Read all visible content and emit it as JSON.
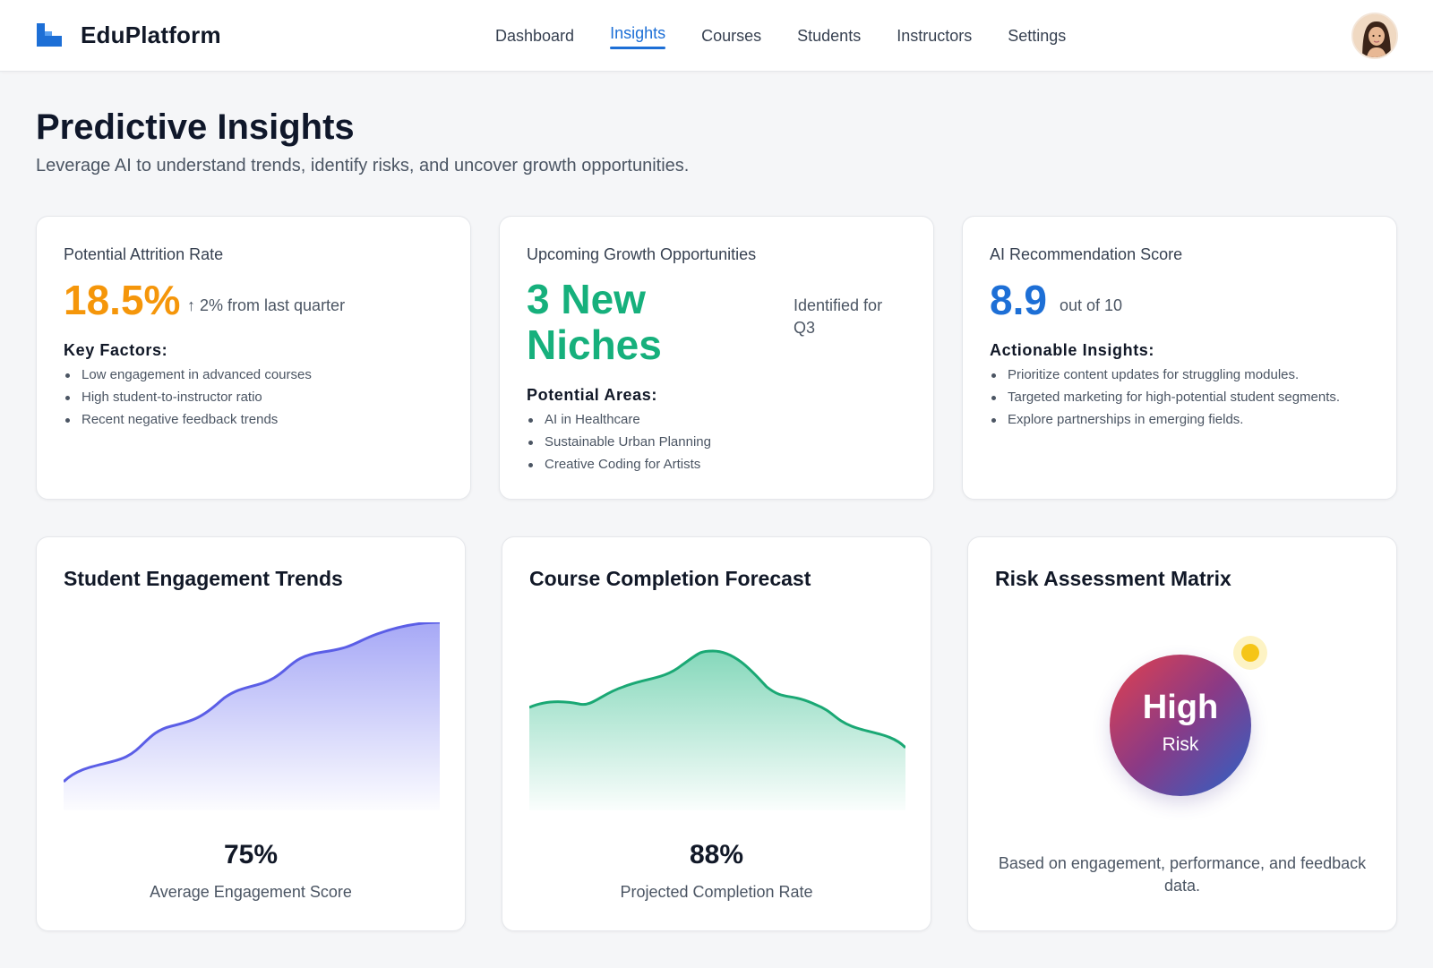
{
  "app": {
    "brand": "EduPlatform"
  },
  "nav": {
    "items": [
      {
        "label": "Dashboard",
        "active": false
      },
      {
        "label": "Insights",
        "active": true
      },
      {
        "label": "Courses",
        "active": false
      },
      {
        "label": "Students",
        "active": false
      },
      {
        "label": "Instructors",
        "active": false
      },
      {
        "label": "Settings",
        "active": false
      }
    ]
  },
  "page": {
    "title": "Predictive Insights",
    "subtitle": "Leverage AI to understand trends, identify risks, and uncover growth opportunities."
  },
  "cards": {
    "attrition": {
      "label": "Potential Attrition Rate",
      "value": "18.5%",
      "change": "↑ 2% from last quarter",
      "section_title": "Key Factors:",
      "factors": [
        "Low engagement in advanced courses",
        "High student-to-instructor ratio",
        "Recent negative feedback trends"
      ],
      "color": "#f5960a"
    },
    "growth": {
      "label": "Upcoming Growth Opportunities",
      "value_line1": "3 New",
      "value_line2": "Niches",
      "note_line1": "Identified for",
      "note_line2": "Q3",
      "section_title": "Potential Areas:",
      "areas": [
        "AI in Healthcare",
        "Sustainable Urban Planning",
        "Creative Coding for Artists"
      ],
      "color": "#16b07c"
    },
    "recommendation": {
      "label": "AI Recommendation Score",
      "value": "8.9",
      "suffix": "out of 10",
      "section_title": "Actionable Insights:",
      "insights": [
        "Prioritize content updates for struggling modules.",
        "Targeted marketing for high-potential student segments.",
        "Explore partnerships in emerging fields."
      ],
      "color": "#1d6fd6"
    }
  },
  "engagement": {
    "title": "Student Engagement Trends",
    "stat": "75%",
    "stat_label": "Average Engagement Score",
    "color": "#6060e8"
  },
  "completion": {
    "title": "Course Completion Forecast",
    "stat": "88%",
    "stat_label": "Projected Completion Rate",
    "color": "#22b883"
  },
  "risk": {
    "title": "Risk Assessment Matrix",
    "level": "High",
    "level_sub": "Risk",
    "caption": "Based on engagement, performance, and feedback data."
  },
  "icons": {
    "logo": "logo-icon",
    "avatar": "user-avatar"
  }
}
